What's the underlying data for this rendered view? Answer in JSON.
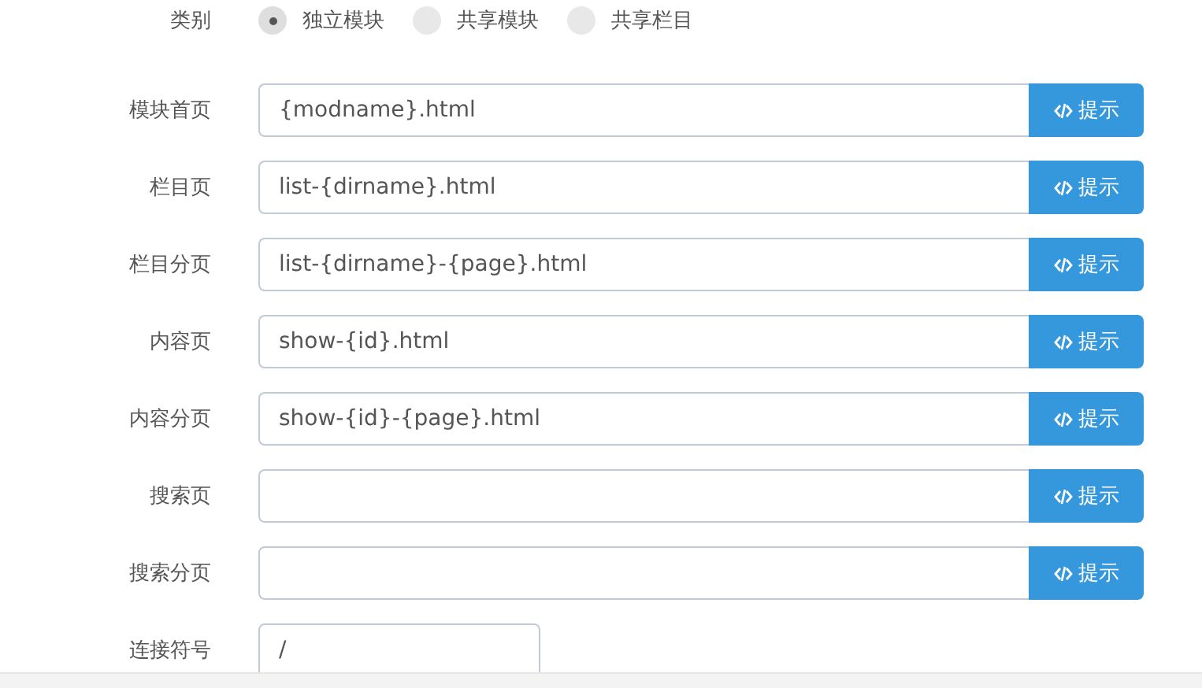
{
  "category": {
    "label": "类别",
    "options": [
      {
        "label": "独立模块",
        "selected": true
      },
      {
        "label": "共享模块",
        "selected": false
      },
      {
        "label": "共享栏目",
        "selected": false
      }
    ]
  },
  "fields": [
    {
      "label": "模块首页",
      "value": "{modname}.html",
      "kind": "hint",
      "button": "提示"
    },
    {
      "label": "栏目页",
      "value": "list-{dirname}.html",
      "kind": "hint",
      "button": "提示"
    },
    {
      "label": "栏目分页",
      "value": "list-{dirname}-{page}.html",
      "kind": "hint",
      "button": "提示"
    },
    {
      "label": "内容页",
      "value": "show-{id}.html",
      "kind": "hint",
      "button": "提示"
    },
    {
      "label": "内容分页",
      "value": "show-{id}-{page}.html",
      "kind": "hint",
      "button": "提示"
    },
    {
      "label": "搜索页",
      "kind": "hint",
      "button": "提示"
    },
    {
      "label": "搜索分页",
      "kind": "hint",
      "button": "提示"
    },
    {
      "label": "连接符号",
      "value": "/",
      "kind": "short"
    }
  ]
}
